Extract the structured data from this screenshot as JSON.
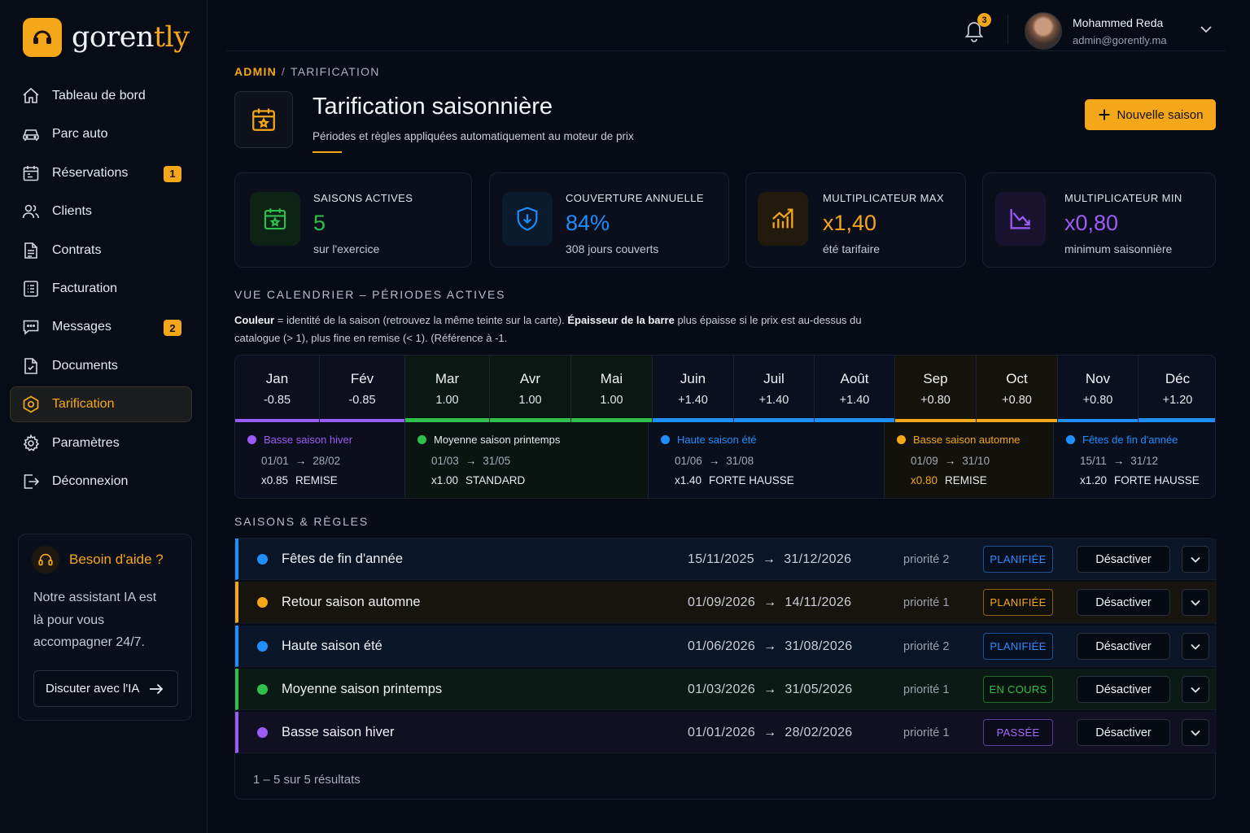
{
  "brand": {
    "name_prefix": "goren",
    "name_suffix": "tly",
    "accent": "#f5a71a"
  },
  "sidebar": {
    "items": [
      {
        "label": "Tableau de bord",
        "icon": "home-icon"
      },
      {
        "label": "Parc auto",
        "icon": "car-icon"
      },
      {
        "label": "Réservations",
        "icon": "calendar-icon",
        "badge": "1"
      },
      {
        "label": "Clients",
        "icon": "users-icon"
      },
      {
        "label": "Contrats",
        "icon": "document-icon"
      },
      {
        "label": "Facturation",
        "icon": "invoice-icon"
      },
      {
        "label": "Messages",
        "icon": "chat-icon",
        "badge": "2"
      },
      {
        "label": "Documents",
        "icon": "file-icon"
      },
      {
        "label": "Tarification",
        "icon": "tag-icon",
        "active": true
      },
      {
        "label": "Paramètres",
        "icon": "gear-icon"
      },
      {
        "label": "Déconnexion",
        "icon": "logout-icon"
      }
    ],
    "help": {
      "title": "Besoin d'aide ?",
      "text": "Notre assistant IA est là pour vous accompagner 24/7.",
      "button": "Discuter avec l'IA"
    }
  },
  "topbar": {
    "notifications": "3",
    "user_name": "Mohammed Reda",
    "user_email": "admin@gorently.ma"
  },
  "header": {
    "breadcrumb": [
      "ADMIN",
      "TARIFICATION"
    ],
    "breadcrumb_sep": "/",
    "title": "Tarification saisonnière",
    "subtitle": "Périodes et règles appliquées automatiquement au moteur de prix",
    "new_button": "Nouvelle saison"
  },
  "stats": [
    {
      "label": "SAISONS ACTIVES",
      "value": "5",
      "note": "sur l'exercice",
      "color": "#2fbf4a",
      "icon": "calendar-star-icon"
    },
    {
      "label": "COUVERTURE ANNUELLE",
      "value": "84%",
      "note": "308 jours couverts",
      "color": "#1f8fff",
      "icon": "shield-icon"
    },
    {
      "label": "MULTIPLICATEUR MAX",
      "value": "x1,40",
      "note": "été tarifaire",
      "color": "#f5a71a",
      "icon": "trend-up-icon"
    },
    {
      "label": "MULTIPLICATEUR MIN",
      "value": "x0,80",
      "note": "minimum saisonnière",
      "color": "#9b5cf6",
      "icon": "trend-down-icon"
    }
  ],
  "calendar": {
    "title": "VUE CALENDRIER – PÉRIODES ACTIVES",
    "legend_bold1": "Couleur",
    "legend_text1": " = identité de la saison (retrouvez la même teinte sur la carte). ",
    "legend_bold2": "Épaisseur de la barre",
    "legend_text2": " plus épaisse si le prix est au-dessus du catalogue (> 1), plus fine en remise (< 1). (Référence à -1.",
    "months": [
      {
        "name": "Jan",
        "value": "-0.85",
        "color": "#9b5cf6"
      },
      {
        "name": "Fév",
        "value": "-0.85",
        "color": "#9b5cf6"
      },
      {
        "name": "Mar",
        "value": "1.00",
        "color": "#2fbf4a"
      },
      {
        "name": "Avr",
        "value": "1.00",
        "color": "#2fbf4a"
      },
      {
        "name": "Mai",
        "value": "1.00",
        "color": "#2fbf4a"
      },
      {
        "name": "Juin",
        "value": "+1.40",
        "color": "#1f8fff"
      },
      {
        "name": "Juil",
        "value": "+1.40",
        "color": "#1f8fff"
      },
      {
        "name": "Août",
        "value": "+1.40",
        "color": "#1f8fff"
      },
      {
        "name": "Sep",
        "value": "+0.80",
        "color": "#f5a71a"
      },
      {
        "name": "Oct",
        "value": "+0.80",
        "color": "#f5a71a"
      },
      {
        "name": "Nov",
        "value": "+0.80",
        "color": "#1f8fff"
      },
      {
        "name": "Déc",
        "value": "+1.20",
        "color": "#1f8fff"
      }
    ],
    "seasons": [
      {
        "name": "Basse saison hiver",
        "start": "01/01",
        "end": "28/02",
        "mult": "x0.85",
        "kind": "REMISE",
        "color": "#9b5cf6"
      },
      {
        "name": "Moyenne saison printemps",
        "start": "01/03",
        "end": "31/05",
        "mult": "x1.00",
        "kind": "STANDARD",
        "color": "#2fbf4a"
      },
      {
        "name": "Haute saison été",
        "start": "01/06",
        "end": "31/08",
        "mult": "x1.40",
        "kind": "FORTE HAUSSE",
        "color": "#1f8fff"
      },
      {
        "name": "Basse saison automne",
        "start": "01/09",
        "end": "31/10",
        "mult": "x0.80",
        "kind": "REMISE",
        "color": "#f5a71a"
      },
      {
        "name": "Fêtes de fin d'année",
        "start": "15/11",
        "end": "31/12",
        "mult": "x1.20",
        "kind": "FORTE HAUSSE",
        "color": "#1f8fff"
      }
    ],
    "arrow": "→"
  },
  "rules": {
    "title": "SAISONS & RÈGLES",
    "rows": [
      {
        "name": "Fêtes de fin d'année",
        "start": "15/11/2025",
        "end": "31/12/2026",
        "priority": "priorité 2",
        "status": "PLANIFIÉE",
        "color": "#1f8fff",
        "status_color": "#2d8cff"
      },
      {
        "name": "Retour saison automne",
        "start": "01/09/2026",
        "end": "14/11/2026",
        "priority": "priorité 1",
        "status": "PLANIFIÉE",
        "color": "#f5a71a",
        "status_color": "#f5a71a"
      },
      {
        "name": "Haute saison été",
        "start": "01/06/2026",
        "end": "31/08/2026",
        "priority": "priorité 2",
        "status": "PLANIFIÉE",
        "color": "#1f8fff",
        "status_color": "#2d8cff"
      },
      {
        "name": "Moyenne saison printemps",
        "start": "01/03/2026",
        "end": "31/05/2026",
        "priority": "priorité 1",
        "status": "EN COURS",
        "color": "#2fbf4a",
        "status_color": "#2fbf4a"
      },
      {
        "name": "Basse saison hiver",
        "start": "01/01/2026",
        "end": "28/02/2026",
        "priority": "priorité 1",
        "status": "PASSÉE",
        "color": "#9b5cf6",
        "status_color": "#a66bff"
      }
    ],
    "deactivate_label": "Désactiver",
    "footer": "1 – 5 sur 5 résultats"
  }
}
